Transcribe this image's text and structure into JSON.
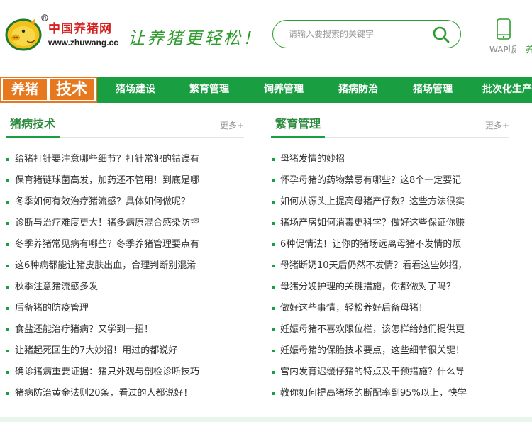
{
  "header": {
    "logo_cn": "中国养猪网",
    "logo_url": "www.zhuwang.cc",
    "slogan": "让养猪更轻松！",
    "search_placeholder": "请输入要搜索的关键字",
    "wap_label": "WAP版",
    "wap_label_next": "养"
  },
  "nav": {
    "brand_a": "养猪",
    "brand_b": "技术",
    "items": [
      "猪场建设",
      "繁育管理",
      "饲养管理",
      "猪病防治",
      "猪场管理",
      "批次化生产"
    ]
  },
  "left": {
    "title": "猪病技术",
    "more": "更多+",
    "items": [
      "给猪打针要注意哪些细节？打针常犯的错误有",
      "保育猪链球菌高发，加药还不管用！到底是哪",
      "冬季如何有效治疗猪流感？具体如何做呢？",
      "诊断与治疗难度更大！猪多病原混合感染防控",
      "冬季养猪常见病有哪些？冬季养猪管理要点有",
      "这6种病都能让猪皮肤出血，合理判断别混淆",
      "秋季注意猪流感多发",
      "后备猪的防疫管理",
      "食盐还能治疗猪病？又学到一招！",
      "让猪起死回生的7大妙招！用过的都说好",
      "确诊猪病重要证据：猪只外观与剖检诊断技巧",
      "猪病防治黄金法则20条，看过的人都说好！"
    ]
  },
  "right": {
    "title": "繁育管理",
    "more": "更多+",
    "items": [
      "母猪发情的妙招",
      "怀孕母猪的药物禁忌有哪些？这8个一定要记",
      "如何从源头上提高母猪产仔数？这些方法很实",
      "猪场产房如何消毒更科学？做好这些保证你赚",
      "6种促情法！让你的猪场远离母猪不发情的烦",
      "母猪断奶10天后仍然不发情？看看这些妙招，",
      "母猪分娩护理的关键措施，你都做对了吗？",
      "做好这些事情，轻松养好后备母猪！",
      "妊娠母猪不喜欢限位栏，该怎样给她们提供更",
      "妊娠母猪的保胎技术要点，这些细节很关键！",
      "宫内发育迟缓仔猪的特点及干预措施？什么导",
      "教你如何提高猪场的断配率到95%以上，快学"
    ]
  },
  "colors": {
    "brand_green": "#1a9e42",
    "brand_orange": "#e8781e",
    "logo_red": "#d62020"
  }
}
